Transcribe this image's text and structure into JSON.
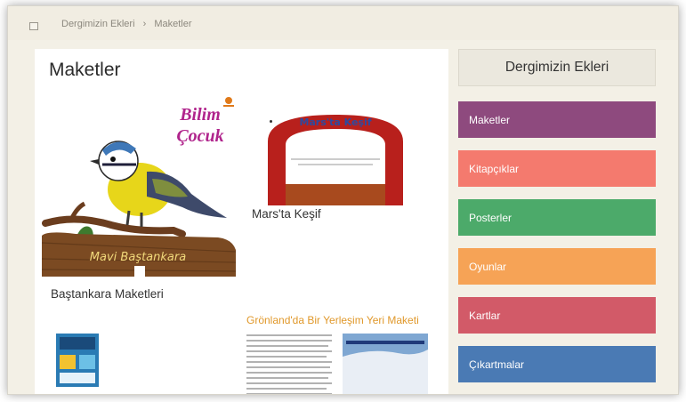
{
  "breadcrumb": {
    "items": [
      "Dergimizin Ekleri",
      "Maketler"
    ]
  },
  "page": {
    "title": "Maketler"
  },
  "cards": {
    "bird": {
      "label": "Baştankara Maketleri",
      "logo_line1": "Bilim",
      "logo_line2": "Çocuk",
      "sign_text": "Mavi Baştankara"
    },
    "mars": {
      "label": "Mars'ta Keşif",
      "arch_text": "Mars'ta Keşif"
    },
    "greenland": {
      "title": "Grönland'da Bir Yerleşim Yeri Maketi"
    }
  },
  "sidebar": {
    "title": "Dergimizin Ekleri",
    "items": [
      {
        "label": "Maketler",
        "color": "#8e4a7e"
      },
      {
        "label": "Kitapçıklar",
        "color": "#f47a6e"
      },
      {
        "label": "Posterler",
        "color": "#4caa6a"
      },
      {
        "label": "Oyunlar",
        "color": "#f6a356"
      },
      {
        "label": "Kartlar",
        "color": "#d25a68"
      },
      {
        "label": "Çıkartmalar",
        "color": "#4a7ab4"
      }
    ]
  }
}
